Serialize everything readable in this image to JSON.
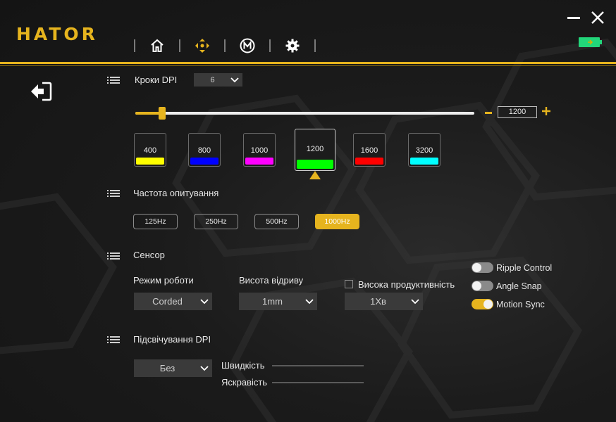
{
  "app": {
    "logo": "HATOR"
  },
  "nav": {
    "items": [
      {
        "name": "home",
        "icon": "home-icon"
      },
      {
        "name": "dpi",
        "icon": "crosshair-icon"
      },
      {
        "name": "macro",
        "icon": "macro-m-icon"
      },
      {
        "name": "settings",
        "icon": "gear-icon"
      }
    ]
  },
  "window": {
    "minimize_icon": "minimize-icon",
    "close_icon": "close-icon",
    "battery_icon": "battery-icon"
  },
  "colors": {
    "accent": "#e6b41e",
    "battery": "#22d67a"
  },
  "dpi_steps": {
    "label": "Кроки DPI",
    "steps_value": "6",
    "current_value": "1200",
    "levels": [
      {
        "value": "400",
        "color": "#ffff00"
      },
      {
        "value": "800",
        "color": "#0000ff"
      },
      {
        "value": "1000",
        "color": "#ff00ff"
      },
      {
        "value": "1200",
        "color": "#00ff00",
        "active": true
      },
      {
        "value": "1600",
        "color": "#ff0000"
      },
      {
        "value": "3200",
        "color": "#00ffff"
      }
    ]
  },
  "polling": {
    "label": "Частота опитування",
    "rates": [
      "125Hz",
      "250Hz",
      "500Hz",
      "1000Hz"
    ],
    "selected": "1000Hz"
  },
  "sensor": {
    "label": "Сенсор",
    "mode_label": "Режим роботи",
    "mode_value": "Corded",
    "lod_label": "Висота відриву",
    "lod_value": "1mm",
    "high_perf_label": "Висока продуктивність",
    "high_perf_value": "1Хв",
    "toggles": [
      {
        "label": "Ripple Control",
        "on": false
      },
      {
        "label": "Angle Snap",
        "on": false
      },
      {
        "label": "Motion Sync",
        "on": true
      }
    ]
  },
  "dpi_lighting": {
    "label": "Підсвічування DPI",
    "mode_value": "Без",
    "speed_label": "Швидкість",
    "brightness_label": "Яскравість"
  }
}
